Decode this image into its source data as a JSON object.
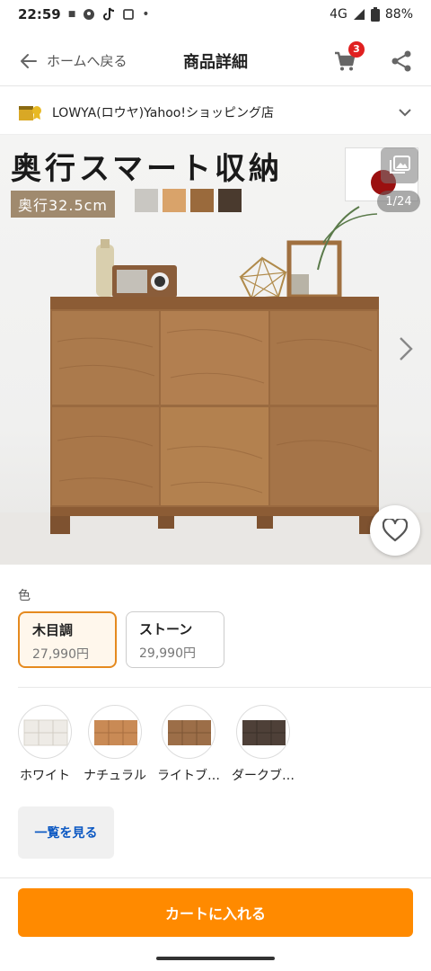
{
  "status_bar": {
    "time": "22:59",
    "network": "4G",
    "battery": "88%",
    "icons_left": [
      "tehu-icon",
      "assistant-icon",
      "tiktok-icon",
      "square-icon",
      "dot-icon"
    ]
  },
  "header": {
    "back_label": "ホームへ戻る",
    "title": "商品詳細",
    "cart_count": "3"
  },
  "store": {
    "name": "LOWYA(ロウヤ)Yahoo!ショッピング店"
  },
  "hero": {
    "title": "奥行スマート収納",
    "depth_tag": "奥行32.5cm",
    "page_counter": "1/24",
    "swatch_colors": [
      "#c9c7c2",
      "#d9a36a",
      "#9a6a3c",
      "#4a3a2e"
    ]
  },
  "color_section": {
    "label": "色",
    "options": [
      {
        "name": "木目調",
        "price": "27,990円",
        "selected": true
      },
      {
        "name": "ストーン",
        "price": "29,990円",
        "selected": false
      }
    ]
  },
  "variants": [
    {
      "label": "ホワイト",
      "color": "#eeebe6"
    },
    {
      "label": "ナチュラル",
      "color": "#c98a55"
    },
    {
      "label": "ライトブ…",
      "color": "#9c6e48"
    },
    {
      "label": "ダークブ…",
      "color": "#4e4038"
    }
  ],
  "list_button": "一覧を見る",
  "cart_button": "カートに入れる",
  "colors": {
    "accent": "#ff8a00",
    "selected_border": "#e58a1f",
    "badge": "#e02020",
    "link": "#0a57c2"
  }
}
